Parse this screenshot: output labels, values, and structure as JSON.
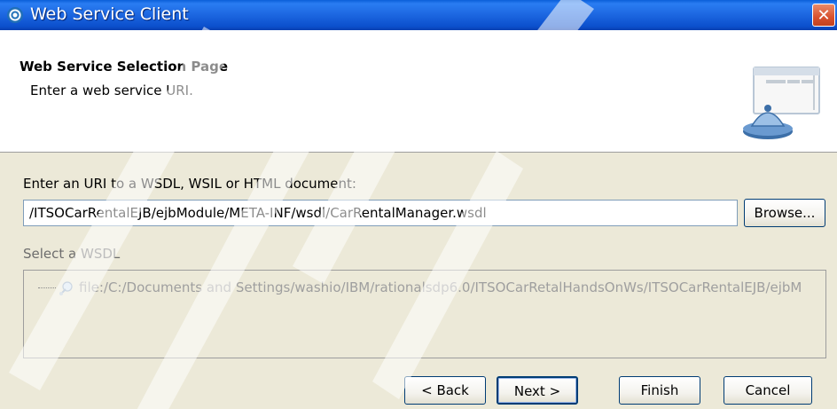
{
  "window": {
    "title": "Web Service Client",
    "close_glyph": "✕"
  },
  "header": {
    "page_title": "Web Service Selection Page",
    "description": "Enter a web service URI."
  },
  "form": {
    "uri_label": "Enter an URI to a WSDL, WSIL or HTML document:",
    "uri_value": "/ITSOCarRentalEJB/ejbModule/META-INF/wsdl/CarRentalManager.wsdl",
    "browse_label": "Browse...",
    "select_wsdl_label": "Select a WSDL",
    "wsdl_tree_item": "file:/C:/Documents and Settings/washio/IBM/rationalsdp6.0/ITSOCarRetalHandsOnWs/ITSOCarRentalEJB/ejbM"
  },
  "buttons": {
    "back": "< Back",
    "next": "Next >",
    "finish": "Finish",
    "cancel": "Cancel"
  },
  "colors": {
    "titlebar": "#0b55d8",
    "dialog_body": "#ece9d8",
    "close": "#d8512e"
  }
}
